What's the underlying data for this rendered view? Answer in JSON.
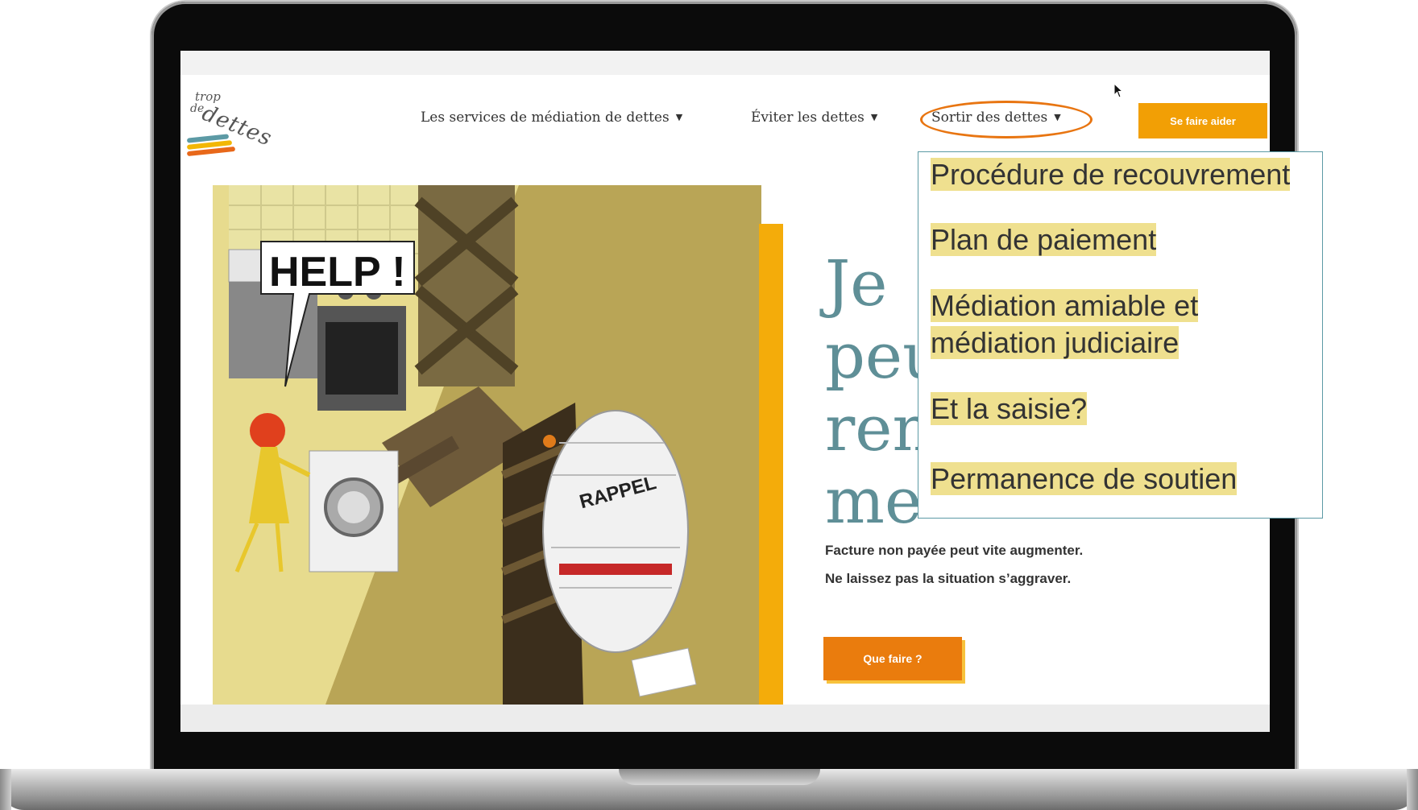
{
  "logo": {
    "line1": "trop",
    "line2": "de",
    "line3": "dettes"
  },
  "nav": {
    "items": [
      {
        "label": "Les services de médiation de dettes"
      },
      {
        "label": "Éviter les dettes"
      },
      {
        "label": "Sortir des dettes"
      }
    ],
    "cta_label": "Se faire aider"
  },
  "illustration": {
    "help_text": "HELP !",
    "paper_text": "RAPPEL"
  },
  "hero": {
    "title_lines": [
      "Je",
      "peu",
      "ren",
      "me"
    ],
    "subtitle_lines": [
      "Facture non payée peut vite augmenter.",
      "Ne laissez pas la situation s’aggraver."
    ],
    "cta_label": "Que faire ?"
  },
  "dropdown": {
    "items": [
      {
        "lines": [
          "Procédure de recouvrement"
        ]
      },
      {
        "lines": [
          "Plan de paiement"
        ]
      },
      {
        "lines": [
          "Médiation amiable et",
          "médiation judiciaire"
        ]
      },
      {
        "lines": [
          "Et la saisie?"
        ]
      },
      {
        "lines": [
          "Permanence de soutien"
        ]
      }
    ]
  },
  "colors": {
    "accent_orange": "#ea7c0d",
    "button_yellow": "#f29f05",
    "hero_title_teal": "#5f8f97",
    "highlight_yellow": "#efe08f"
  }
}
